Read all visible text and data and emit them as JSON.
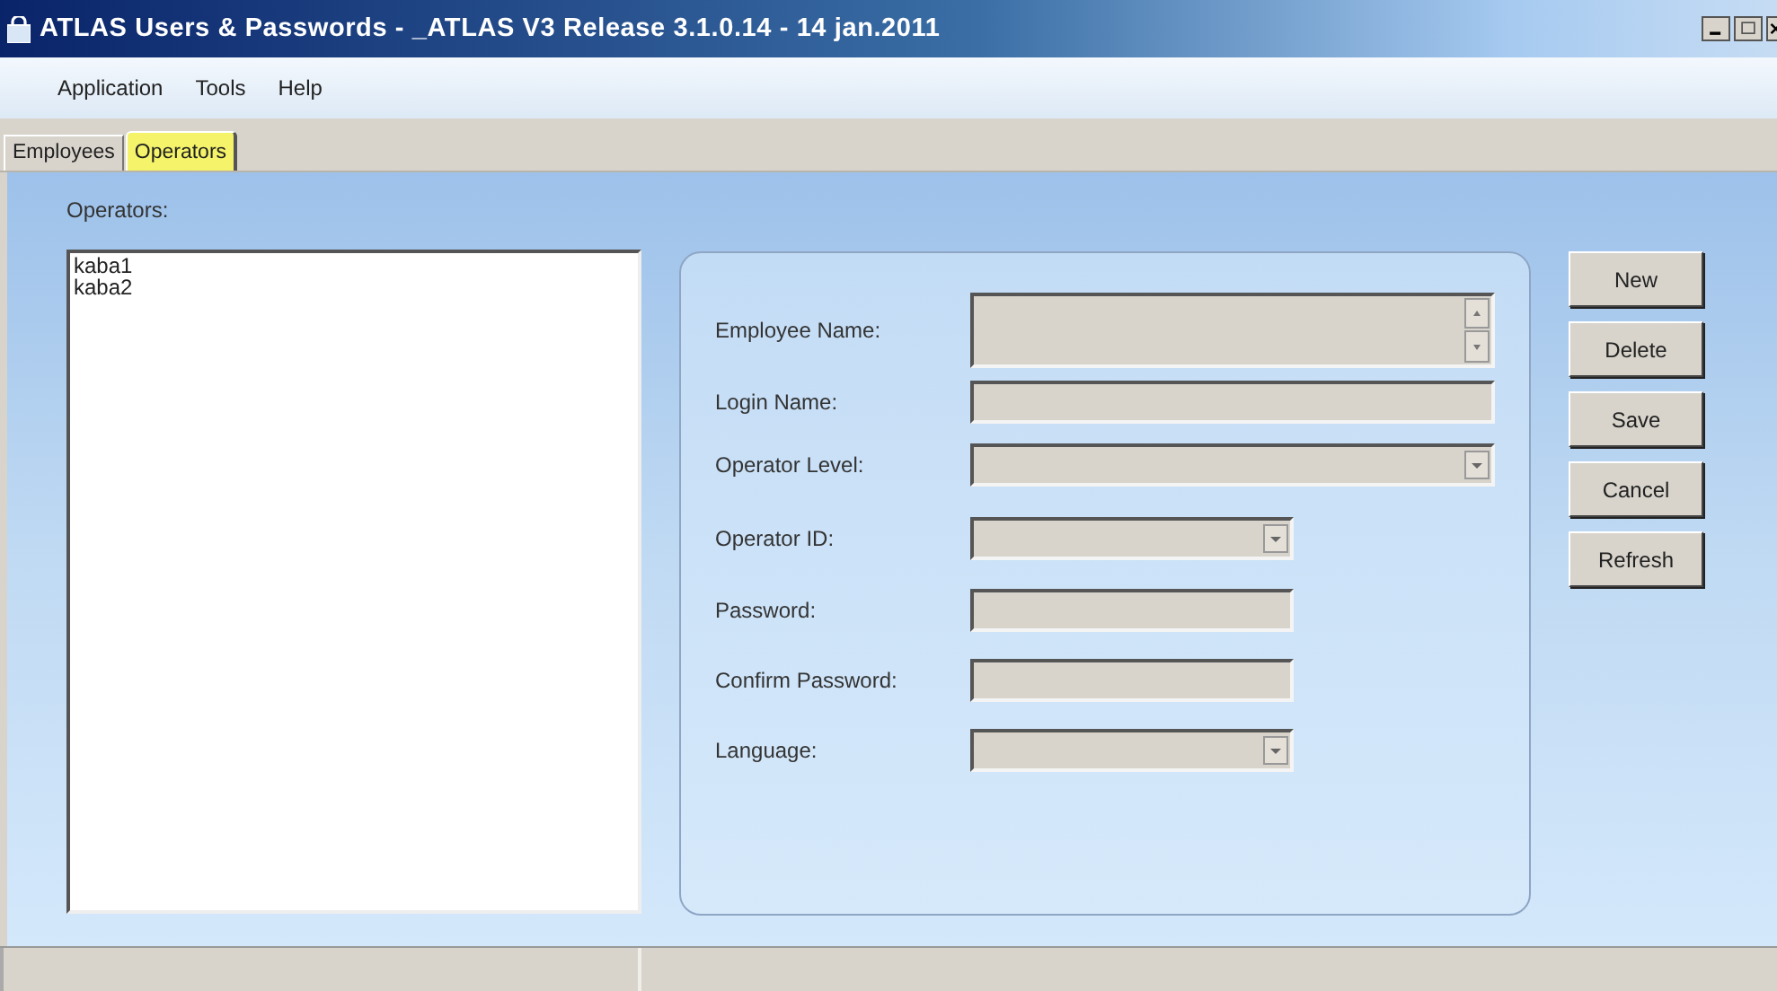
{
  "window": {
    "title": "ATLAS Users & Passwords - _ATLAS V3  Release 3.1.0.14 - 14 jan.2011"
  },
  "menu": [
    "Application",
    "Tools",
    "Help"
  ],
  "tabs": [
    {
      "label": "Employees",
      "selected": false
    },
    {
      "label": "Operators",
      "selected": true
    }
  ],
  "operators": {
    "label": "Operators:",
    "items": [
      "kaba1",
      "kaba2"
    ]
  },
  "form": [
    {
      "label": "Employee Name:",
      "kind": "memo",
      "disabled": true
    },
    {
      "label": "Login Name:",
      "kind": "text",
      "disabled": true
    },
    {
      "label": "Operator Level:",
      "kind": "combo",
      "disabled": true
    },
    {
      "label": "Operator ID:",
      "kind": "combo",
      "disabled": true
    },
    {
      "label": "Password:",
      "kind": "text",
      "disabled": true
    },
    {
      "label": "Confirm Password:",
      "kind": "text",
      "disabled": true
    },
    {
      "label": "Language:",
      "kind": "combo",
      "disabled": true
    }
  ],
  "buttons": [
    "New",
    "Delete",
    "Save",
    "Cancel",
    "Refresh"
  ]
}
